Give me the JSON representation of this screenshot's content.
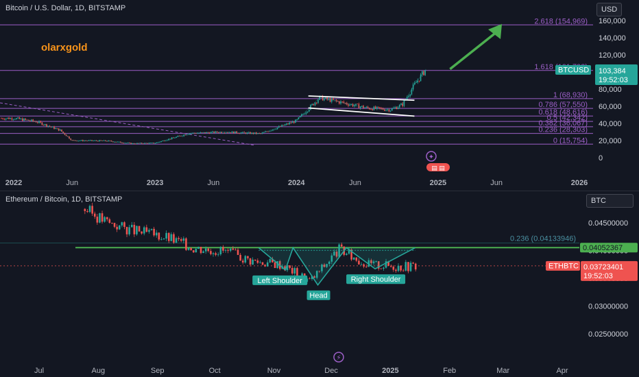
{
  "top_chart": {
    "title": "Bitcoin / U.S. Dollar, 1D, BITSTAMP",
    "currency": "USD",
    "watermark": "olarxgold",
    "y_ticks": [
      "160,000",
      "140,000",
      "120,000",
      "100,000",
      "80,000",
      "60,000",
      "40,000",
      "20,000",
      "0"
    ],
    "x_ticks": [
      "2022",
      "Jun",
      "2023",
      "Jun",
      "2024",
      "Jun",
      "2025",
      "Jun",
      "2026"
    ],
    "fib_levels": [
      {
        "label": "2.618 (154,969)",
        "value": 154969
      },
      {
        "label": "1.618 (101,793)",
        "value": 101793
      },
      {
        "label": "1 (68,930)",
        "value": 68930
      },
      {
        "label": "0.786 (57,550)",
        "value": 57550
      },
      {
        "label": "0.618 (48,616)",
        "value": 48616
      },
      {
        "label": "0.5 (42,342)",
        "value": 42342
      },
      {
        "label": "0.382 (36,067)",
        "value": 36067
      },
      {
        "label": "0.236 (28,303)",
        "value": 28303
      },
      {
        "label": "0 (15,754)",
        "value": 15754
      }
    ],
    "symbol_tag": "BTCUSD",
    "last_price": "103,384",
    "countdown": "19:52:03",
    "accent_green": "#26a69a",
    "fib_color": "#9c5fc7",
    "arrow_color": "#4caf50"
  },
  "bottom_chart": {
    "title": "Ethereum / Bitcoin, 1D, BITSTAMP",
    "currency": "BTC",
    "y_ticks": [
      "0.04500000",
      "0.04000000",
      "0.03500000",
      "0.03000000",
      "0.02500000"
    ],
    "x_ticks": [
      "Jul",
      "Aug",
      "Sep",
      "Oct",
      "Nov",
      "Dec",
      "2025",
      "Feb",
      "Mar",
      "Apr"
    ],
    "fib_label": "0.236 (0.04133946)",
    "neckline_price": "0.04052367",
    "symbol_tag": "ETHBTC",
    "last_price": "0.03723401",
    "countdown": "19:52:03",
    "pattern_labels": {
      "left": "Left Shoulder",
      "head": "Head",
      "right": "Right Shoulder"
    },
    "neck_color": "#4caf50",
    "down_color": "#ef5350"
  },
  "chart_data": [
    {
      "type": "line",
      "title": "Bitcoin / U.S. Dollar, 1D, BITSTAMP",
      "xlabel": "",
      "ylabel": "USD",
      "ylim": [
        0,
        165000
      ],
      "x": [
        "2022-01",
        "2022-03",
        "2022-05",
        "2022-06",
        "2022-09",
        "2022-11",
        "2023-01",
        "2023-04",
        "2023-07",
        "2023-10",
        "2024-01",
        "2024-03",
        "2024-05",
        "2024-07",
        "2024-09",
        "2024-10",
        "2024-11",
        "2024-12"
      ],
      "series": [
        {
          "name": "BTCUSD",
          "values": [
            46000,
            42000,
            32000,
            20000,
            19500,
            16500,
            17000,
            28500,
            30000,
            28000,
            43000,
            70000,
            64000,
            58000,
            56000,
            62000,
            85000,
            103384
          ]
        }
      ],
      "fib_levels": [
        154969,
        101793,
        68930,
        57550,
        48616,
        42342,
        36067,
        28303,
        15754
      ]
    },
    {
      "type": "line",
      "title": "Ethereum / Bitcoin, 1D, BITSTAMP",
      "xlabel": "",
      "ylabel": "BTC",
      "ylim": [
        0.023,
        0.0475
      ],
      "x": [
        "2024-07-25",
        "2024-08-05",
        "2024-08-20",
        "2024-09-05",
        "2024-09-20",
        "2024-10-05",
        "2024-10-20",
        "2024-11-05",
        "2024-11-20",
        "2024-12-05",
        "2024-12-20",
        "2025-01-05",
        "2025-01-15"
      ],
      "series": [
        {
          "name": "ETHBTC",
          "values": [
            0.0475,
            0.0452,
            0.0435,
            0.0425,
            0.0405,
            0.04,
            0.0382,
            0.0375,
            0.0345,
            0.0402,
            0.0375,
            0.0372,
            0.03723401
          ]
        }
      ],
      "levels": {
        "neckline": 0.04052367,
        "fib_0_236": 0.04133946
      }
    }
  ]
}
